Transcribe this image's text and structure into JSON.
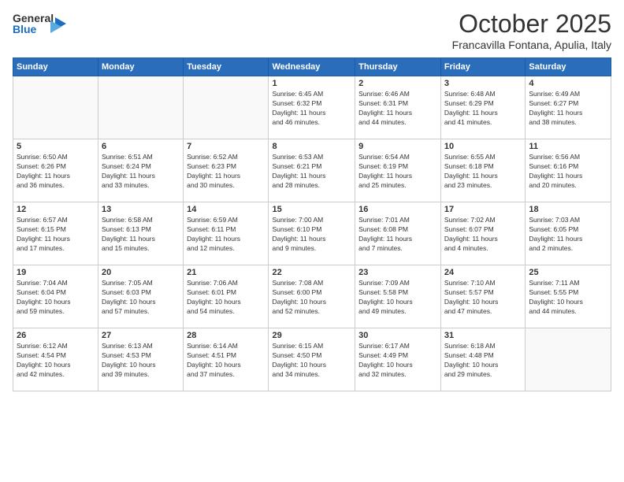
{
  "header": {
    "logo_general": "General",
    "logo_blue": "Blue",
    "month_title": "October 2025",
    "subtitle": "Francavilla Fontana, Apulia, Italy"
  },
  "days_of_week": [
    "Sunday",
    "Monday",
    "Tuesday",
    "Wednesday",
    "Thursday",
    "Friday",
    "Saturday"
  ],
  "weeks": [
    [
      {
        "day": "",
        "info": ""
      },
      {
        "day": "",
        "info": ""
      },
      {
        "day": "",
        "info": ""
      },
      {
        "day": "1",
        "info": "Sunrise: 6:45 AM\nSunset: 6:32 PM\nDaylight: 11 hours\nand 46 minutes."
      },
      {
        "day": "2",
        "info": "Sunrise: 6:46 AM\nSunset: 6:31 PM\nDaylight: 11 hours\nand 44 minutes."
      },
      {
        "day": "3",
        "info": "Sunrise: 6:48 AM\nSunset: 6:29 PM\nDaylight: 11 hours\nand 41 minutes."
      },
      {
        "day": "4",
        "info": "Sunrise: 6:49 AM\nSunset: 6:27 PM\nDaylight: 11 hours\nand 38 minutes."
      }
    ],
    [
      {
        "day": "5",
        "info": "Sunrise: 6:50 AM\nSunset: 6:26 PM\nDaylight: 11 hours\nand 36 minutes."
      },
      {
        "day": "6",
        "info": "Sunrise: 6:51 AM\nSunset: 6:24 PM\nDaylight: 11 hours\nand 33 minutes."
      },
      {
        "day": "7",
        "info": "Sunrise: 6:52 AM\nSunset: 6:23 PM\nDaylight: 11 hours\nand 30 minutes."
      },
      {
        "day": "8",
        "info": "Sunrise: 6:53 AM\nSunset: 6:21 PM\nDaylight: 11 hours\nand 28 minutes."
      },
      {
        "day": "9",
        "info": "Sunrise: 6:54 AM\nSunset: 6:19 PM\nDaylight: 11 hours\nand 25 minutes."
      },
      {
        "day": "10",
        "info": "Sunrise: 6:55 AM\nSunset: 6:18 PM\nDaylight: 11 hours\nand 23 minutes."
      },
      {
        "day": "11",
        "info": "Sunrise: 6:56 AM\nSunset: 6:16 PM\nDaylight: 11 hours\nand 20 minutes."
      }
    ],
    [
      {
        "day": "12",
        "info": "Sunrise: 6:57 AM\nSunset: 6:15 PM\nDaylight: 11 hours\nand 17 minutes."
      },
      {
        "day": "13",
        "info": "Sunrise: 6:58 AM\nSunset: 6:13 PM\nDaylight: 11 hours\nand 15 minutes."
      },
      {
        "day": "14",
        "info": "Sunrise: 6:59 AM\nSunset: 6:11 PM\nDaylight: 11 hours\nand 12 minutes."
      },
      {
        "day": "15",
        "info": "Sunrise: 7:00 AM\nSunset: 6:10 PM\nDaylight: 11 hours\nand 9 minutes."
      },
      {
        "day": "16",
        "info": "Sunrise: 7:01 AM\nSunset: 6:08 PM\nDaylight: 11 hours\nand 7 minutes."
      },
      {
        "day": "17",
        "info": "Sunrise: 7:02 AM\nSunset: 6:07 PM\nDaylight: 11 hours\nand 4 minutes."
      },
      {
        "day": "18",
        "info": "Sunrise: 7:03 AM\nSunset: 6:05 PM\nDaylight: 11 hours\nand 2 minutes."
      }
    ],
    [
      {
        "day": "19",
        "info": "Sunrise: 7:04 AM\nSunset: 6:04 PM\nDaylight: 10 hours\nand 59 minutes."
      },
      {
        "day": "20",
        "info": "Sunrise: 7:05 AM\nSunset: 6:03 PM\nDaylight: 10 hours\nand 57 minutes."
      },
      {
        "day": "21",
        "info": "Sunrise: 7:06 AM\nSunset: 6:01 PM\nDaylight: 10 hours\nand 54 minutes."
      },
      {
        "day": "22",
        "info": "Sunrise: 7:08 AM\nSunset: 6:00 PM\nDaylight: 10 hours\nand 52 minutes."
      },
      {
        "day": "23",
        "info": "Sunrise: 7:09 AM\nSunset: 5:58 PM\nDaylight: 10 hours\nand 49 minutes."
      },
      {
        "day": "24",
        "info": "Sunrise: 7:10 AM\nSunset: 5:57 PM\nDaylight: 10 hours\nand 47 minutes."
      },
      {
        "day": "25",
        "info": "Sunrise: 7:11 AM\nSunset: 5:55 PM\nDaylight: 10 hours\nand 44 minutes."
      }
    ],
    [
      {
        "day": "26",
        "info": "Sunrise: 6:12 AM\nSunset: 4:54 PM\nDaylight: 10 hours\nand 42 minutes."
      },
      {
        "day": "27",
        "info": "Sunrise: 6:13 AM\nSunset: 4:53 PM\nDaylight: 10 hours\nand 39 minutes."
      },
      {
        "day": "28",
        "info": "Sunrise: 6:14 AM\nSunset: 4:51 PM\nDaylight: 10 hours\nand 37 minutes."
      },
      {
        "day": "29",
        "info": "Sunrise: 6:15 AM\nSunset: 4:50 PM\nDaylight: 10 hours\nand 34 minutes."
      },
      {
        "day": "30",
        "info": "Sunrise: 6:17 AM\nSunset: 4:49 PM\nDaylight: 10 hours\nand 32 minutes."
      },
      {
        "day": "31",
        "info": "Sunrise: 6:18 AM\nSunset: 4:48 PM\nDaylight: 10 hours\nand 29 minutes."
      },
      {
        "day": "",
        "info": ""
      }
    ]
  ]
}
